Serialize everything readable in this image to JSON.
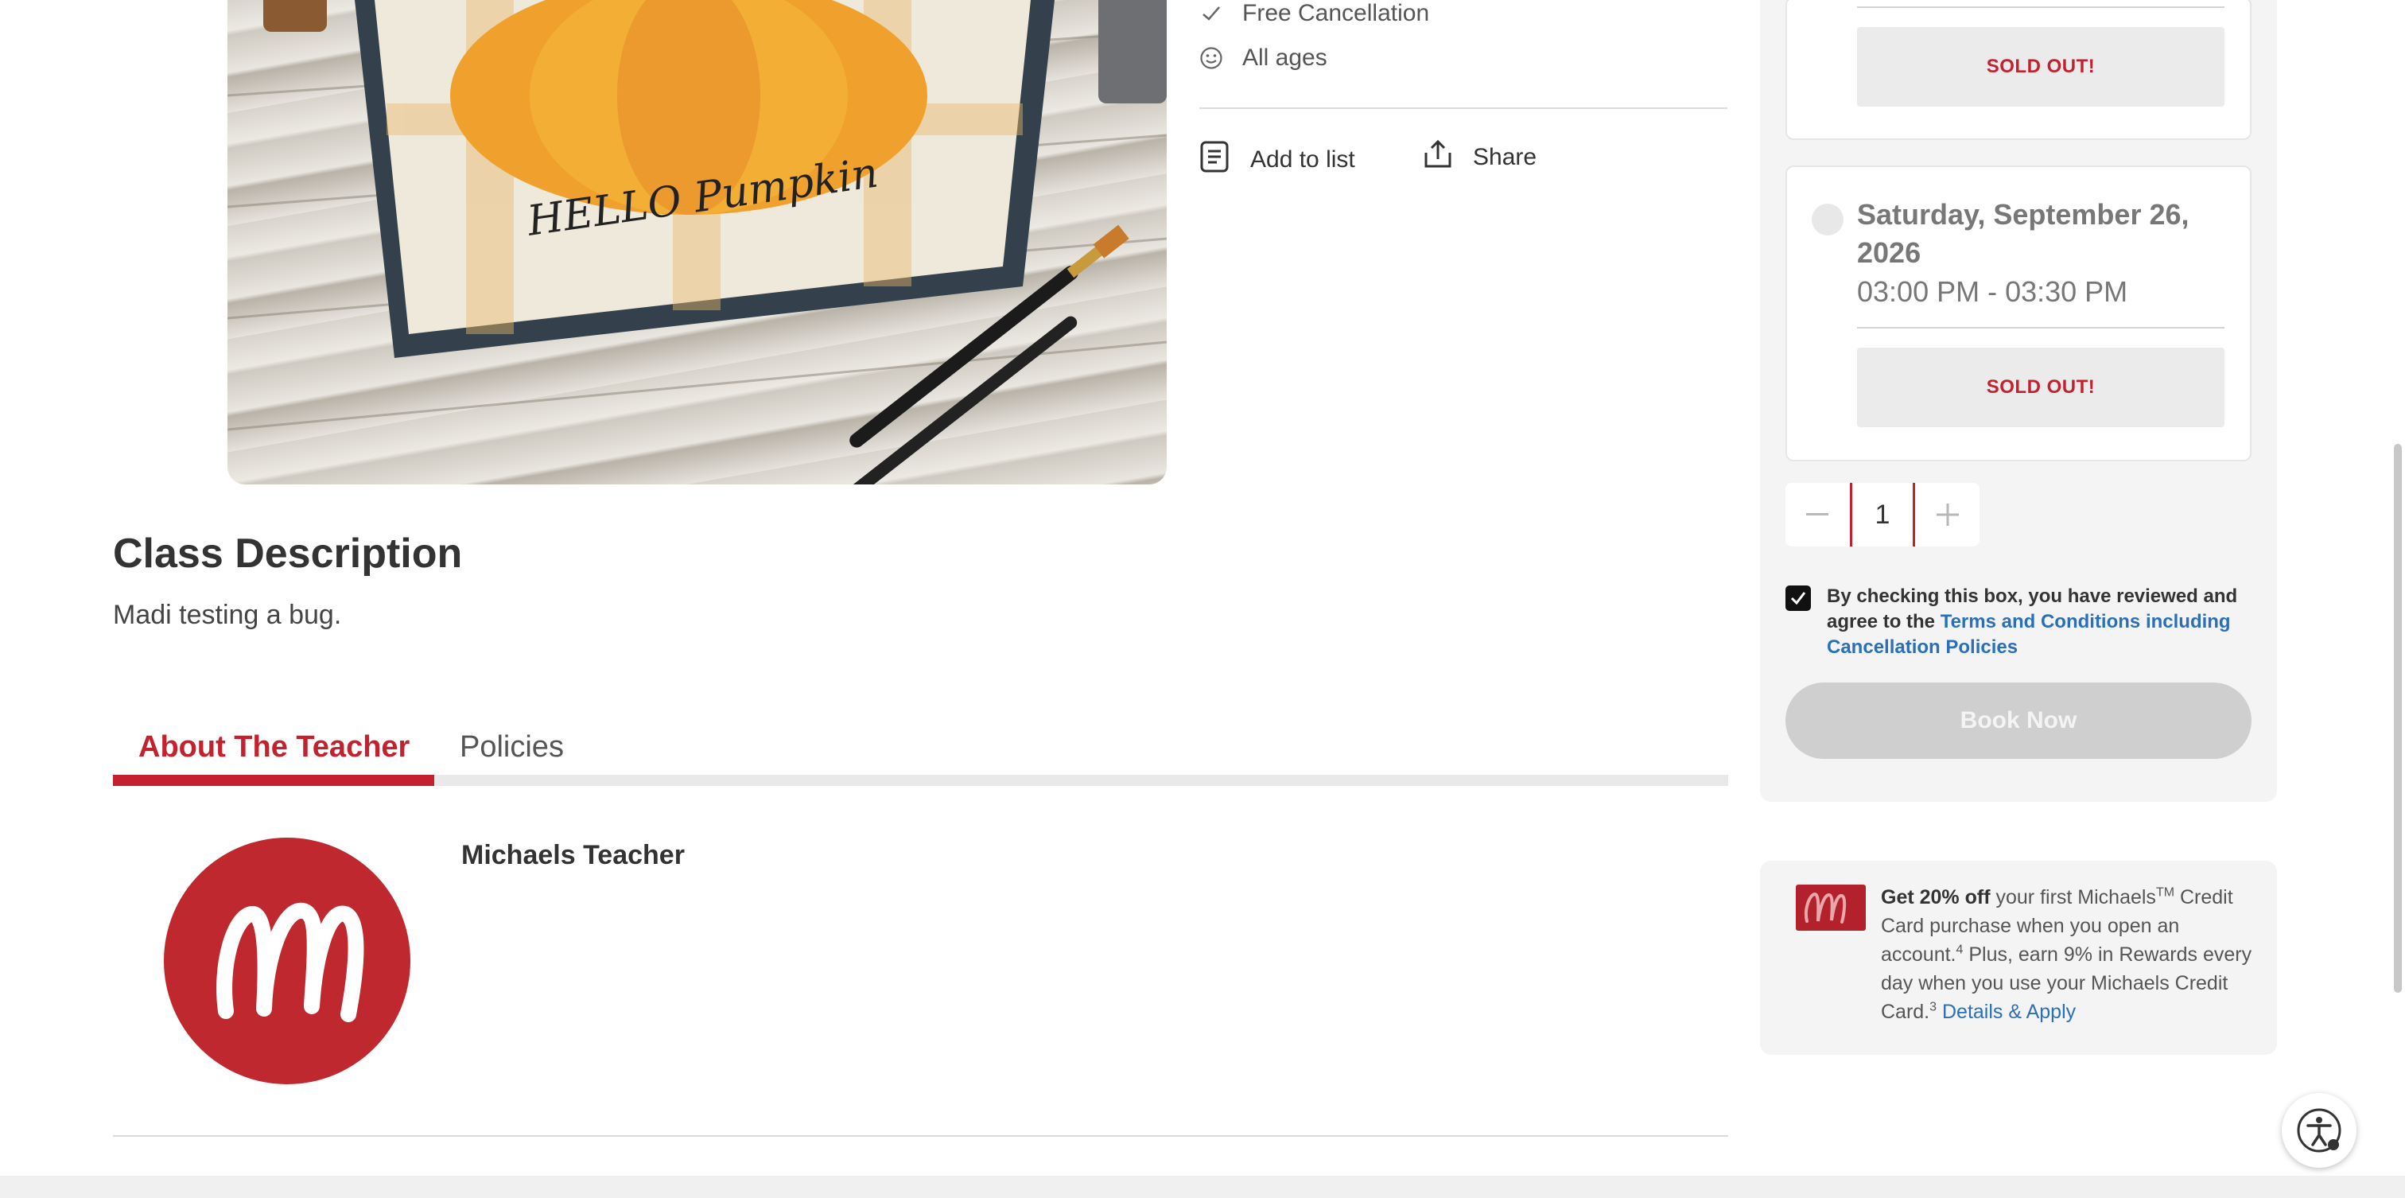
{
  "features": [
    {
      "icon": "check-icon",
      "label": "Free Cancellation"
    },
    {
      "icon": "smiley-icon",
      "label": "All ages"
    }
  ],
  "actions": {
    "add_to_list": "Add to list",
    "share": "Share"
  },
  "hero": {
    "image_text": "HELLO Pumpkin"
  },
  "description": {
    "title": "Class Description",
    "text": "Madi testing a bug."
  },
  "tabs": [
    {
      "label": "About The Teacher",
      "active": true
    },
    {
      "label": "Policies",
      "active": false
    }
  ],
  "teacher": {
    "name": "Michaels Teacher",
    "logo_letter": "M"
  },
  "booking": {
    "slots": [
      {
        "button": "SOLD OUT!"
      },
      {
        "date": "Saturday, September 26, 2026",
        "time": "03:00 PM - 03:30 PM",
        "button": "SOLD OUT!"
      }
    ],
    "quantity": "1",
    "terms_checked": true,
    "terms_text": "By checking this box, you have reviewed and agree to the",
    "terms_link": "Terms and Conditions including Cancellation Policies",
    "book_label": "Book Now"
  },
  "offer": {
    "bold": "Get 20% off",
    "text1": "your first Michaels",
    "tm": "TM",
    "text2": "Credit Card purchase when you open an account.",
    "sup1": "4",
    "text3": "Plus, earn 9% in Rewards every day when you use your Michaels Credit Card.",
    "sup2": "3",
    "link": "Details & Apply"
  },
  "colors": {
    "brand_red": "#c4212f",
    "link_blue": "#2a6fb8",
    "panel_bg": "#f4f4f4"
  }
}
